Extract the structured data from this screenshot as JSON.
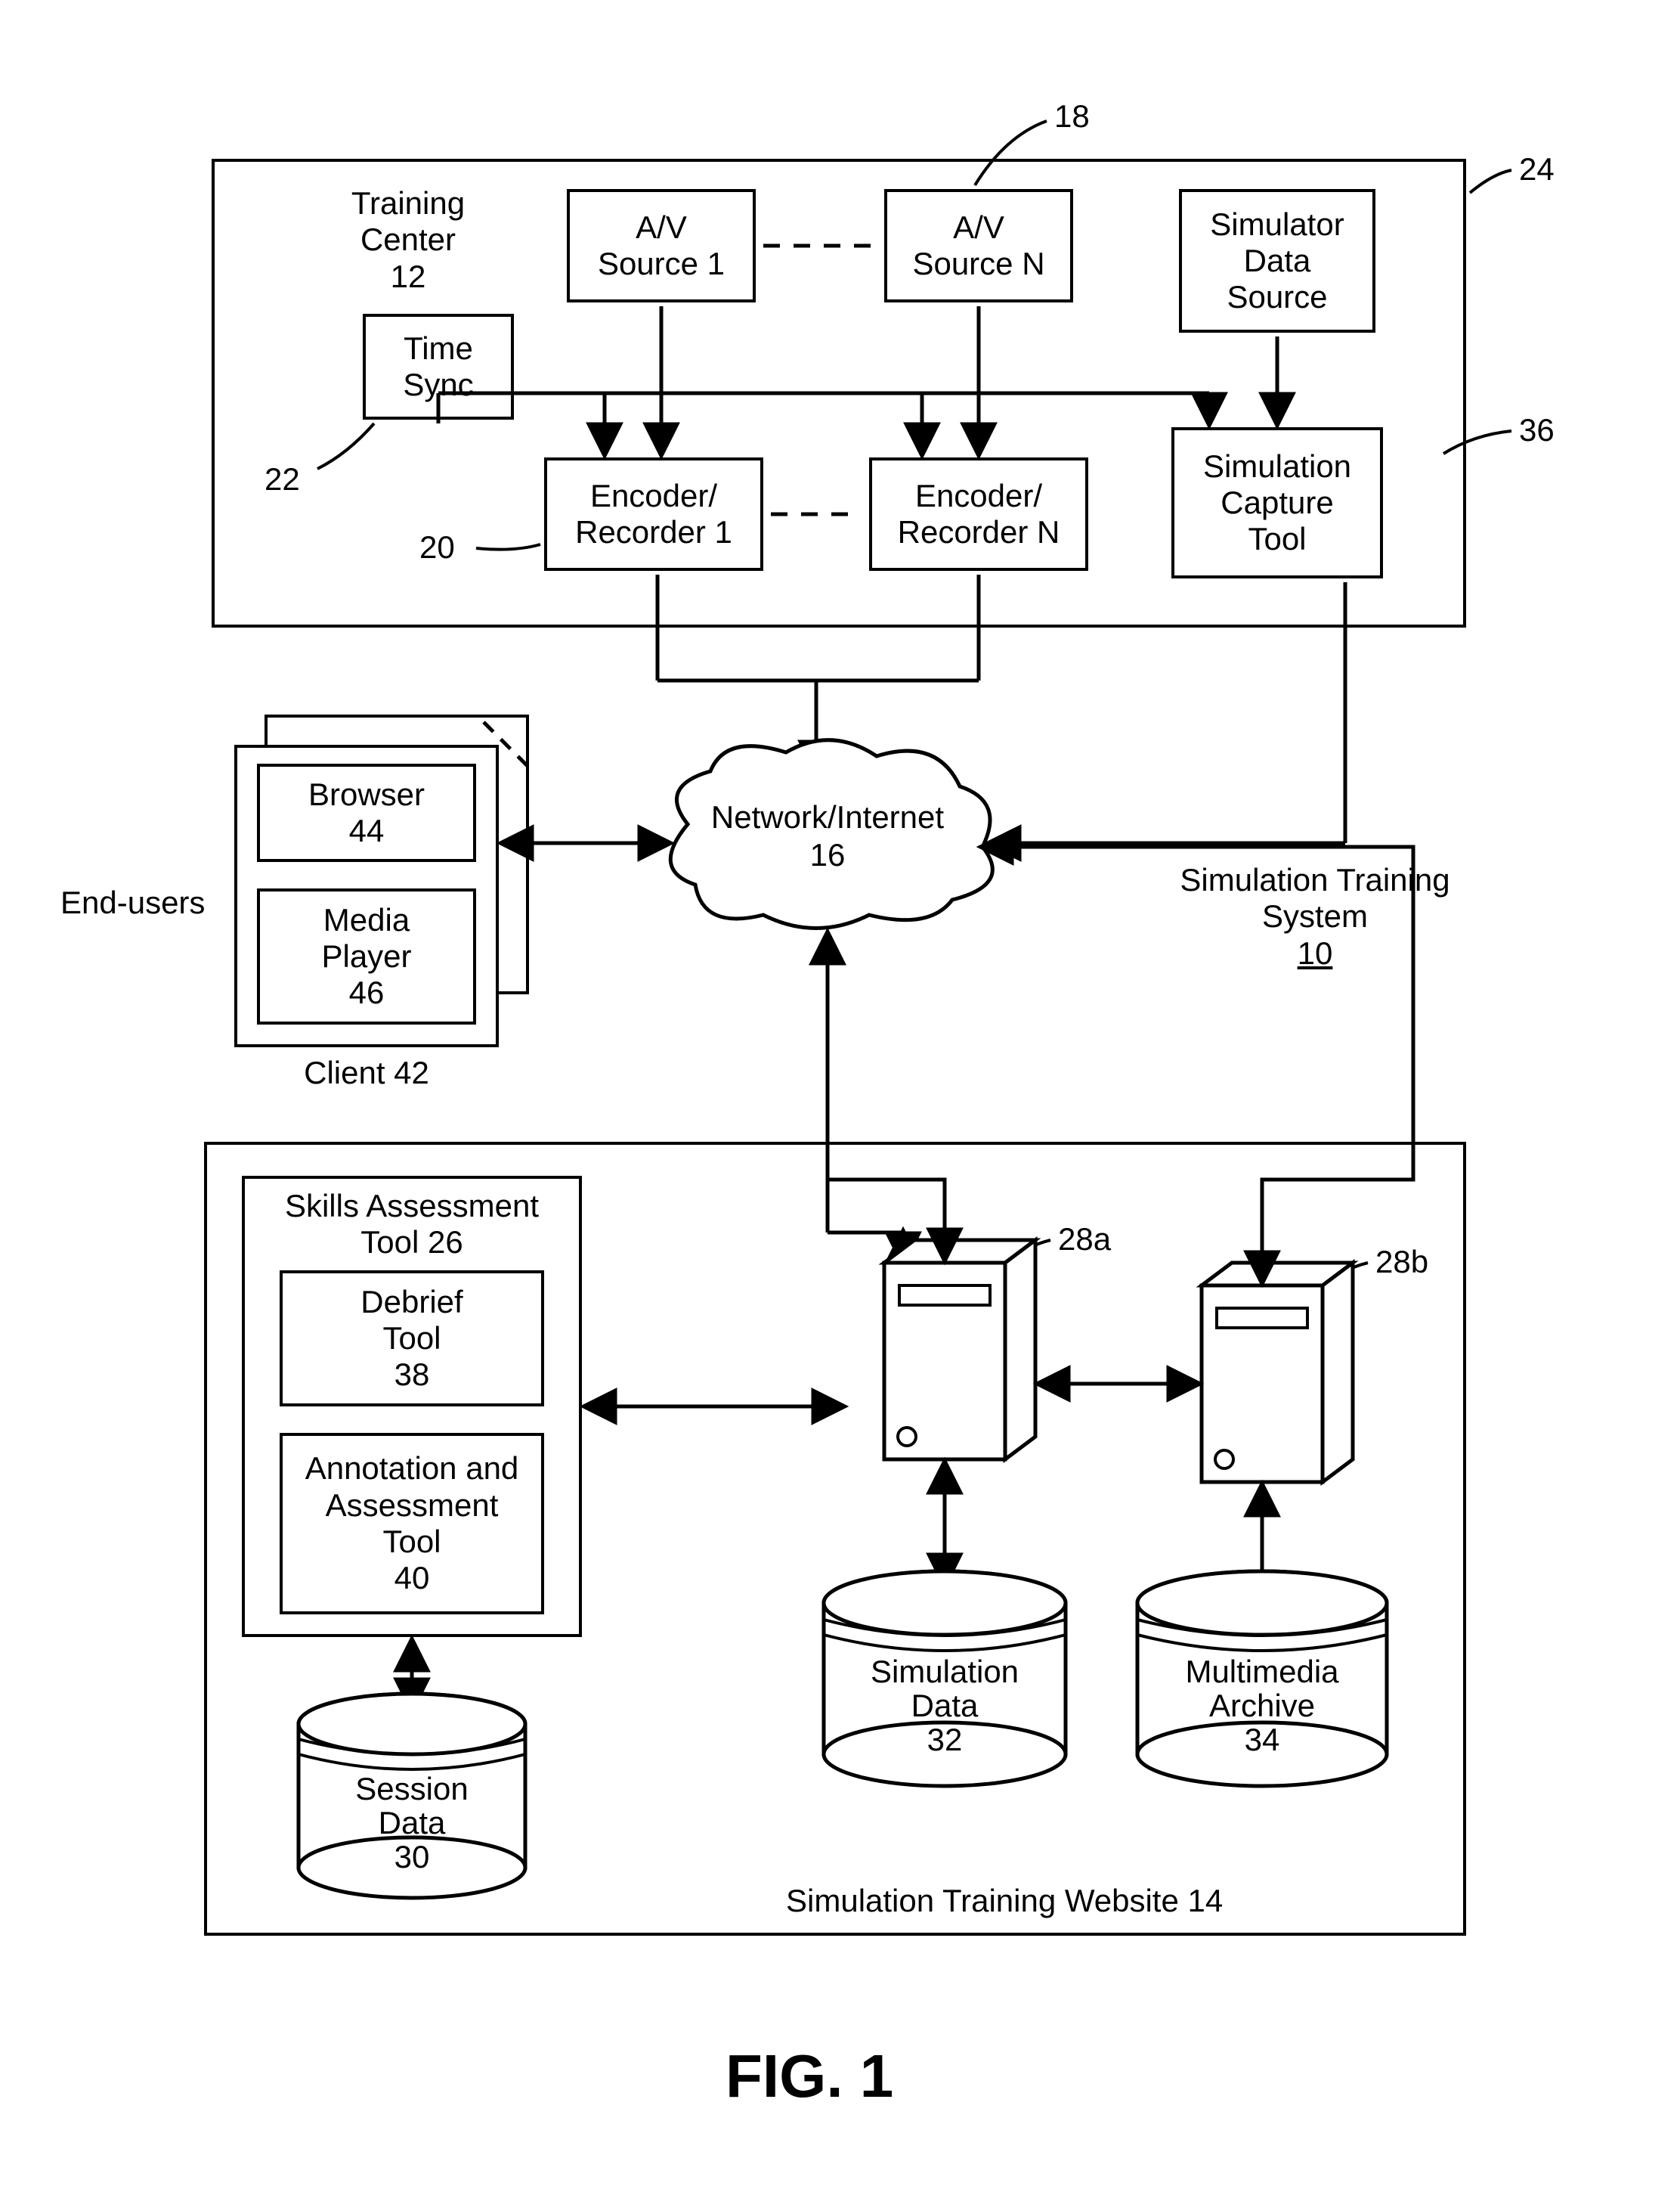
{
  "fig_label": "FIG. 1",
  "training_center": {
    "title_line1": "Training",
    "title_line2": "Center",
    "ref": "12",
    "leader_ref": "24",
    "av_source_1": {
      "l1": "A/V",
      "l2": "Source 1"
    },
    "av_source_n": {
      "l1": "A/V",
      "l2": "Source N",
      "leader_ref": "18"
    },
    "sim_data_source": {
      "l1": "Simulator",
      "l2": "Data",
      "l3": "Source"
    },
    "time_sync": {
      "l1": "Time",
      "l2": "Sync",
      "leader_ref": "22"
    },
    "encoder_1": {
      "l1": "Encoder/",
      "l2": "Recorder 1",
      "leader_ref": "20"
    },
    "encoder_n": {
      "l1": "Encoder/",
      "l2": "Recorder N"
    },
    "sim_capture": {
      "l1": "Simulation",
      "l2": "Capture",
      "l3": "Tool",
      "leader_ref": "36"
    }
  },
  "network": {
    "l1": "Network/Internet",
    "l2": "16"
  },
  "end_users_label": "End-users",
  "client": {
    "title": "Client 42",
    "browser": {
      "l1": "Browser",
      "l2": "44"
    },
    "media_player": {
      "l1": "Media",
      "l2": "Player",
      "l3": "46"
    }
  },
  "system_label": {
    "l1": "Simulation Training",
    "l2": "System",
    "ref": "10"
  },
  "website": {
    "title": "Simulation Training Website 14",
    "skills_tool": {
      "l1": "Skills Assessment",
      "l2": "Tool  26"
    },
    "debrief": {
      "l1": "Debrief",
      "l2": "Tool",
      "l3": "38"
    },
    "annotation": {
      "l1": "Annotation and",
      "l2": "Assessment",
      "l3": "Tool",
      "l4": "40"
    },
    "server_a_ref": "28a",
    "server_b_ref": "28b",
    "db_session": {
      "l1": "Session",
      "l2": "Data",
      "l3": "30"
    },
    "db_sim": {
      "l1": "Simulation",
      "l2": "Data",
      "l3": "32"
    },
    "db_archive": {
      "l1": "Multimedia",
      "l2": "Archive",
      "l3": "34"
    }
  }
}
